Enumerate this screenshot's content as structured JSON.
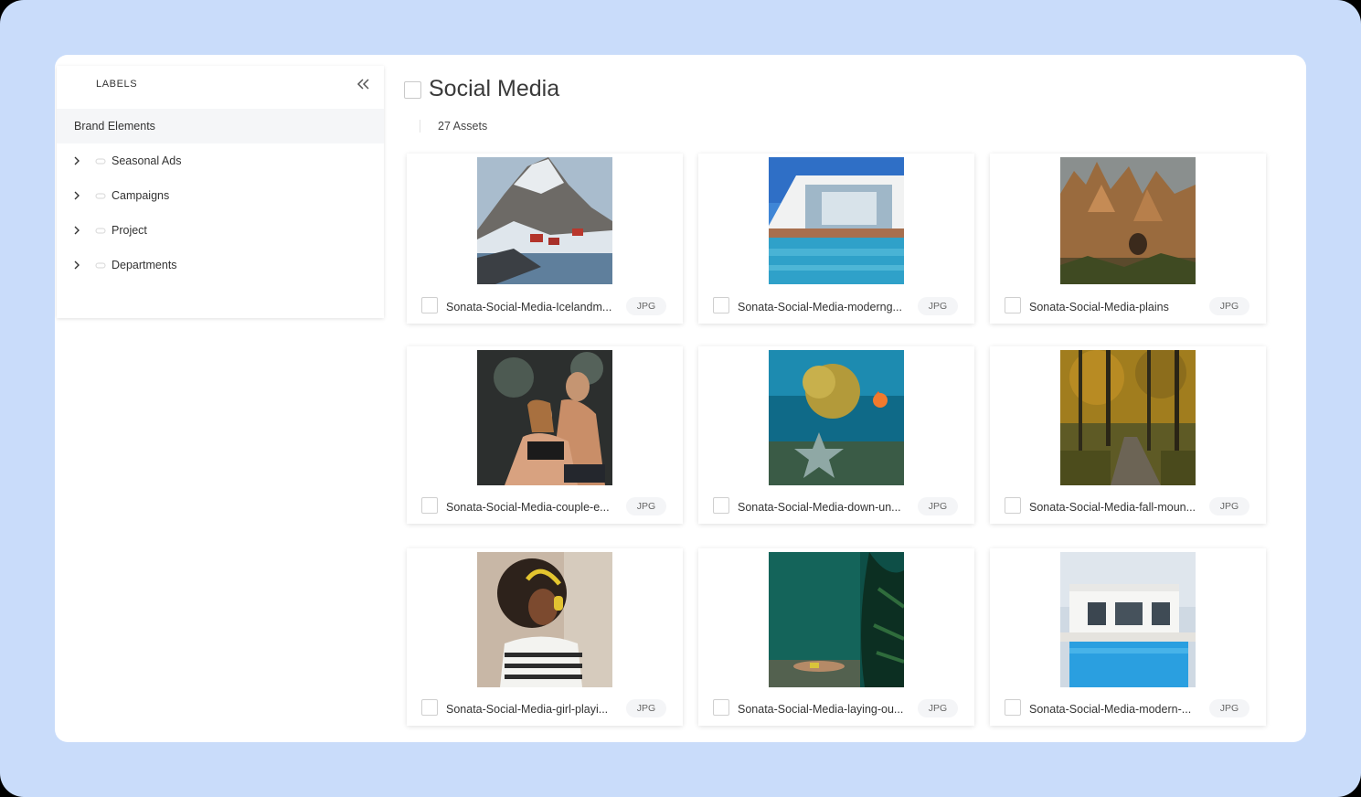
{
  "sidebar": {
    "title": "LABELS",
    "root": "Brand Elements",
    "items": [
      {
        "label": "Seasonal Ads"
      },
      {
        "label": "Campaigns"
      },
      {
        "label": "Project"
      },
      {
        "label": "Departments"
      }
    ]
  },
  "main": {
    "title": "Social Media",
    "asset_count": "27 Assets",
    "assets": [
      {
        "name": "Sonata-Social-Media-Icelandm...",
        "type": "JPG"
      },
      {
        "name": "Sonata-Social-Media-moderng...",
        "type": "JPG"
      },
      {
        "name": "Sonata-Social-Media-plains",
        "type": "JPG"
      },
      {
        "name": "Sonata-Social-Media-couple-e...",
        "type": "JPG"
      },
      {
        "name": "Sonata-Social-Media-down-un...",
        "type": "JPG"
      },
      {
        "name": "Sonata-Social-Media-fall-moun...",
        "type": "JPG"
      },
      {
        "name": "Sonata-Social-Media-girl-playi...",
        "type": "JPG"
      },
      {
        "name": "Sonata-Social-Media-laying-ou...",
        "type": "JPG"
      },
      {
        "name": "Sonata-Social-Media-modern-...",
        "type": "JPG"
      }
    ]
  },
  "icons": {
    "collapse": "double-chevron-left-icon",
    "expand": "chevron-right-icon",
    "label_tag": "tag-outline-icon"
  },
  "colors": {
    "background": "#c9dcfa",
    "panel": "#ffffff",
    "selected_row": "#f5f6f8",
    "badge": "#f4f5f7"
  }
}
